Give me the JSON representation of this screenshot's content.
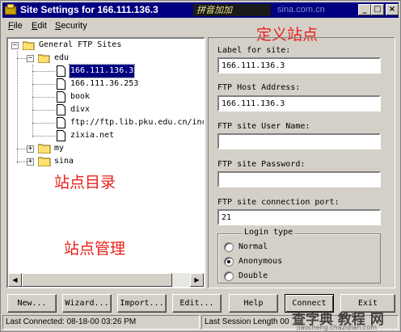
{
  "window": {
    "title": "Site Settings for 166.111.136.3",
    "title_stamp": "拼音加加",
    "title_watermark": "sina.com.cn",
    "controls": {
      "minimize": "_",
      "maximize": "□",
      "close": "×"
    }
  },
  "menu": [
    {
      "label": "File",
      "mnemonic": "F",
      "rest": "ile"
    },
    {
      "label": "Edit",
      "mnemonic": "E",
      "rest": "dit"
    },
    {
      "label": "Security",
      "mnemonic": "S",
      "rest": "ecurity"
    }
  ],
  "annotations": {
    "define_site": "定义站点",
    "site_directory": "站点目录",
    "site_management": "站点管理"
  },
  "tree": {
    "root": {
      "label": "General FTP Sites",
      "expander": "−"
    },
    "edu": {
      "label": "edu",
      "expander": "−"
    },
    "edu_children": [
      {
        "label": "166.111.136.3",
        "selected": true
      },
      {
        "label": "166.111.36.253",
        "selected": false
      },
      {
        "label": "book",
        "selected": false
      },
      {
        "label": "divx",
        "selected": false
      },
      {
        "label": "ftp://ftp.lib.pku.edu.cn/inc",
        "selected": false
      },
      {
        "label": "zixia.net",
        "selected": false
      }
    ],
    "my": {
      "label": "my",
      "expander": "+"
    },
    "sina": {
      "label": "sina",
      "expander": "+"
    }
  },
  "form": {
    "label_for_site": {
      "label": "Label for site:",
      "mnemonic": "L",
      "value": "166.111.136.3"
    },
    "ftp_host": {
      "label": "FTP Host Address:",
      "mnemonic": "H",
      "value": "166.111.136.3"
    },
    "user_name": {
      "label": "FTP site User Name:",
      "mnemonic": "U",
      "value": ""
    },
    "password": {
      "label": "FTP site Password:",
      "mnemonic": "P",
      "value": ""
    },
    "port": {
      "label": "FTP site connection port:",
      "mnemonic": "p",
      "value": "21"
    },
    "login_type": {
      "title": "Login type",
      "options": [
        {
          "label": "Normal",
          "selected": false
        },
        {
          "label": "Anonymous",
          "selected": true
        },
        {
          "label": "Double",
          "selected": false
        }
      ]
    }
  },
  "buttons": {
    "new": "New...",
    "wizard": "Wizard...",
    "import": "Import...",
    "edit": "Edit...",
    "help": "Help",
    "connect": "Connect",
    "exit": "Exit"
  },
  "status": {
    "last_connected": "Last Connected: 08-18-00 03:26 PM",
    "last_session": "Last Session Length 00"
  },
  "watermark": {
    "main": "查字典 教程 网",
    "sub": "jiaocheng.chazidian.com"
  }
}
